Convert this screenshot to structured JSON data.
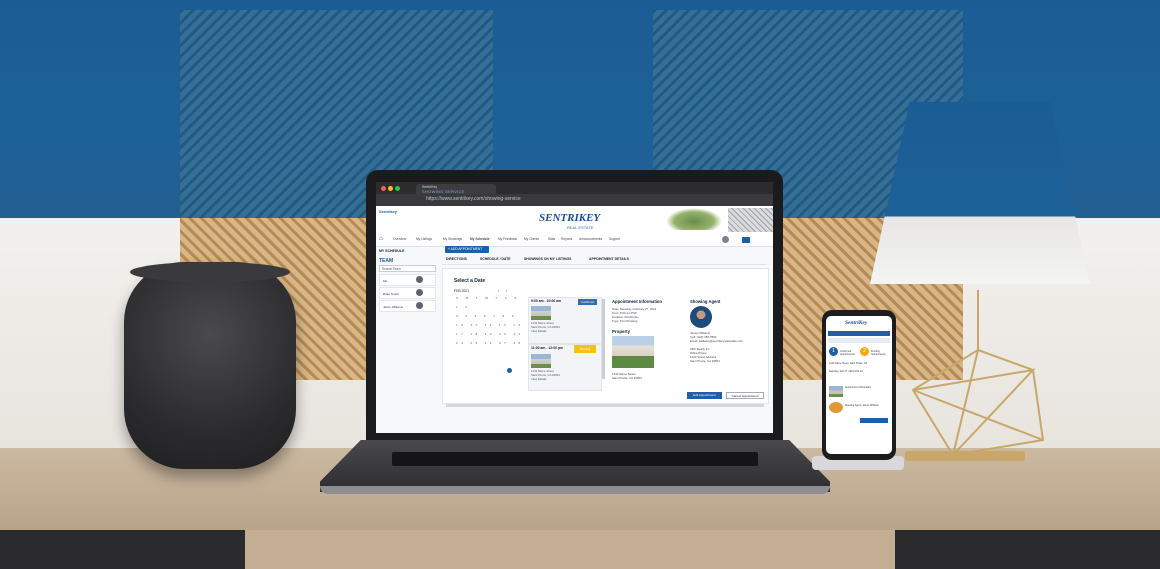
{
  "browser": {
    "tab_title": "SentriKey",
    "tab_subtitle": "SHOWING SERVICE",
    "url": "https://www.sentrikey.com/showing-service"
  },
  "app": {
    "logo_small": "Sentrikey",
    "logo_main": "SENTRIKEY",
    "logo_tagline": "REAL ESTATE",
    "nav": [
      "Overview",
      "My Listings",
      "My Showings",
      "My Schedule",
      "My Feedback",
      "My Clients",
      "Stats",
      "Reports",
      "Announcements",
      "Support"
    ],
    "schedule_title": "MY SCHEDULE",
    "add_appointment": "+ ADD APPOINTMENT",
    "team_label": "TEAM",
    "team_search_placeholder": "Search Team",
    "team_members": [
      "Me",
      "Brian Smith",
      "Jason Williams"
    ],
    "tabs": [
      "DIRECTIONS",
      "SCHEDULE / DATE",
      "SHOWINGS ON MY LISTINGS",
      "APPOINTMENT DETAILS"
    ],
    "select_date": "Select a Date",
    "month": "FEB 2021",
    "cal_weekdays": "S M T W T F S",
    "cal_weeks": [
      "1 2",
      "3 4 5 6 7 8 9",
      "10 11 12 13 14 15 16",
      "17 18 19 20 21 22 23",
      "24 25 26 27 28"
    ],
    "slots": [
      {
        "time": "9:00 am - 10:00 am",
        "address": "1234 Name Street",
        "city": "Saint Pinole, CA 94564",
        "link": "View Details",
        "tag": "Confirmed"
      },
      {
        "time": "11:00 am - 12:00 pm",
        "address": "1234 Name Street",
        "city": "Saint Pinole, CA 94564",
        "link": "View Details",
        "tag": "Pending"
      }
    ],
    "appointment_info_title": "Appointment Information",
    "appointment_lines": [
      "Date: Saturday, February 27, 2021",
      "Time: 9:00 am PST",
      "Duration: 60 Minutes",
      "Type: First Showing"
    ],
    "property_title": "Property",
    "property_address": [
      "1234 Name Street",
      "Saint Pinole, CA 94564"
    ],
    "agent_title": "Showing Agent",
    "agent_lines": [
      "James Williams",
      "Cell: (123) 456-7890",
      "Email: jwilliams@sentrikeyrealestate.com",
      "",
      "ABC Realty Inc.",
      "Office Phone",
      "1234 Street Address",
      "Saint Pinole, CA 94564"
    ],
    "edit_button": "Edit Appointment",
    "cancel_button": "Cancel Appointment"
  },
  "phone": {
    "logo": "SentriKey",
    "step1": "1",
    "step2": "2",
    "lines": [
      "Confirmed Appointments",
      "Pending Appointments",
      "1234 Name Street, Saint Pinole, CA",
      "Saturday, Feb 27, 2021 9:00 am",
      "Appointment Information",
      "Showing Agent: James Williams"
    ]
  }
}
